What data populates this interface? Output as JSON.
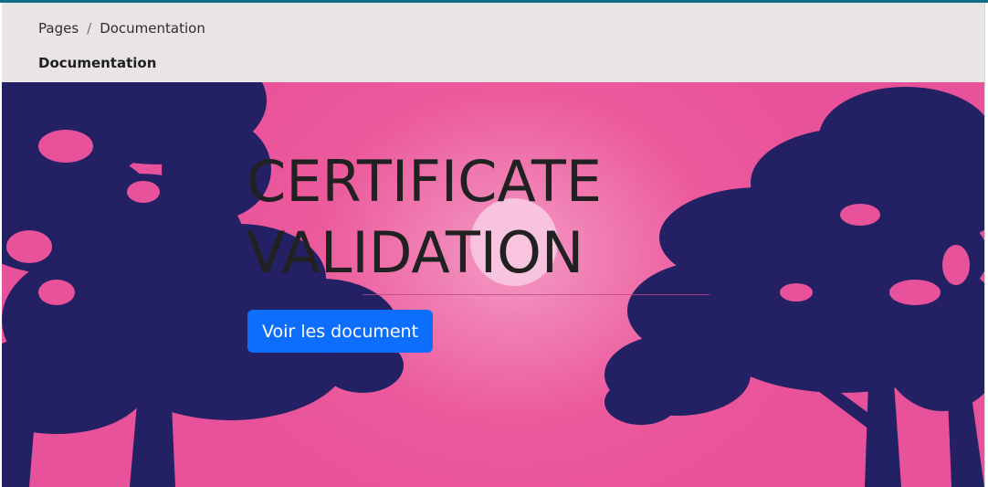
{
  "breadcrumb": {
    "root": "Pages",
    "separator": "/",
    "current": "Documentation"
  },
  "header": {
    "title": "Documentation"
  },
  "hero": {
    "title_line1": "CERTIFICATE",
    "title_line2": "VALIDATION",
    "button_label": "Voir les document"
  },
  "colors": {
    "accent_bar": "#0f6d86",
    "header_bg": "#e9e5e4",
    "hero_pink": "#e8529a",
    "tree_silhouette": "#232164",
    "button_blue": "#0d6efd"
  }
}
